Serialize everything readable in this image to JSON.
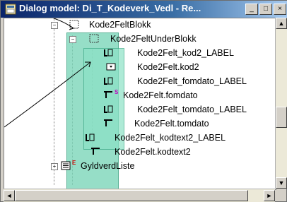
{
  "window": {
    "title": "Dialog model: Di_T_Kodeverk_Vedl - Re...",
    "buttons": {
      "minimize": "_",
      "maximize": "□",
      "close": "×"
    }
  },
  "tree": {
    "items": [
      {
        "label": "Kode2FeltBlokk"
      },
      {
        "label": "Kode2FeltUnderBlokk"
      },
      {
        "label": "Kode2Felt_kod2_LABEL"
      },
      {
        "label": "Kode2Felt.kod2"
      },
      {
        "label": "Kode2Felt_fomdato_LABEL"
      },
      {
        "label": "Kode2Felt.fomdato"
      },
      {
        "label": "Kode2Felt_tomdato_LABEL"
      },
      {
        "label": "Kode2Felt.tomdato"
      },
      {
        "label": "Kode2Felt_kodtext2_LABEL"
      },
      {
        "label": "Kode2Felt.kodtext2"
      },
      {
        "label": "GyldverdListe"
      }
    ],
    "badges": {
      "fomdato": "S",
      "gyldverd": "E"
    }
  },
  "scrollbars": {
    "up": "▲",
    "down": "▼",
    "left": "◄",
    "right": "►"
  },
  "colors": {
    "highlight": "#79d6b8",
    "titlebar": "#0a246a"
  }
}
